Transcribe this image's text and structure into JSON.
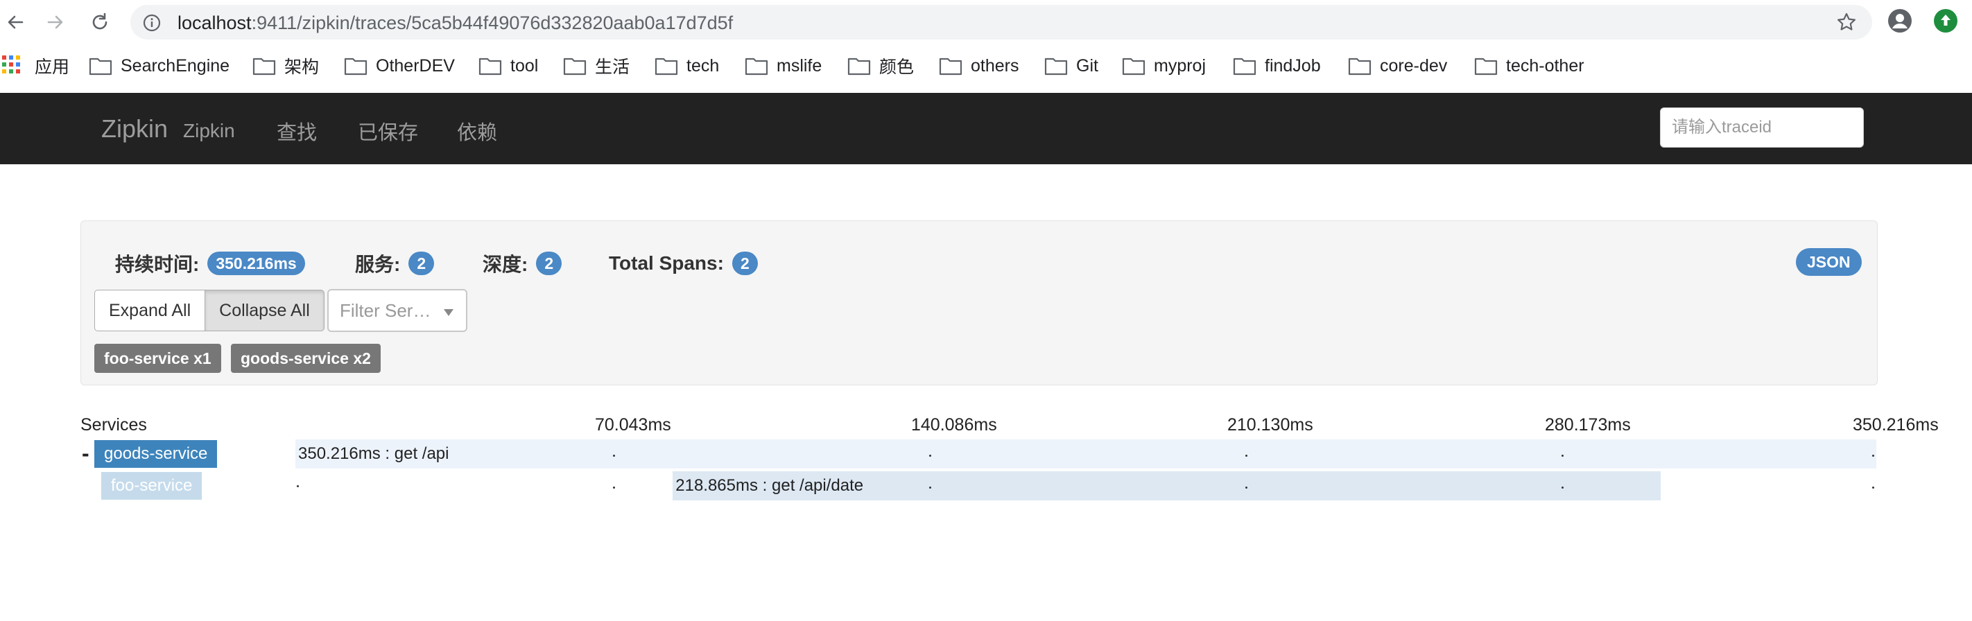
{
  "browser": {
    "url_host": "localhost",
    "url_rest": ":9411/zipkin/traces/5ca5b44f49076d332820aab0a17d7d5f",
    "bookmarks": [
      "应用",
      "SearchEngine",
      "架构",
      "OtherDEV",
      "tool",
      "生活",
      "tech",
      "mslife",
      "颜色",
      "others",
      "Git",
      "myproj",
      "findJob",
      "core-dev",
      "tech-other"
    ]
  },
  "navbar": {
    "brand": "Zipkin",
    "brand_sub": "Zipkin",
    "links": [
      "查找",
      "已保存",
      "依赖"
    ],
    "traceid_placeholder": "请输入traceid"
  },
  "summary": {
    "duration_label": "持续时间:",
    "duration_value": "350.216ms",
    "services_label": "服务:",
    "services_value": "2",
    "depth_label": "深度:",
    "depth_value": "2",
    "spans_label": "Total Spans:",
    "spans_value": "2",
    "json_label": "JSON",
    "expand_all": "Expand All",
    "collapse_all": "Collapse All",
    "filter_placeholder": "Filter Ser…",
    "service_tags": [
      "foo-service x1",
      "goods-service x2"
    ]
  },
  "timeline": {
    "services_header": "Services",
    "ticks": [
      "70.043ms",
      "140.086ms",
      "210.130ms",
      "280.173ms",
      "350.216ms"
    ],
    "toggle": "-",
    "rows": [
      {
        "service": "goods-service",
        "span": "350.216ms : get /api",
        "start_ms": 0,
        "duration_ms": 350.216
      },
      {
        "service": "foo-service",
        "span": "218.865ms : get /api/date",
        "start_ms": 83.6,
        "duration_ms": 218.865
      }
    ]
  },
  "colors": {
    "navbar_bg": "#222222",
    "badge": "#4a88c6",
    "service_tag": "#777777",
    "row_parent_bg": "#edf3fb",
    "row_child_bg": "#dde8f3",
    "label_parent": "#3d84bc",
    "label_child": "#c5dbec"
  }
}
